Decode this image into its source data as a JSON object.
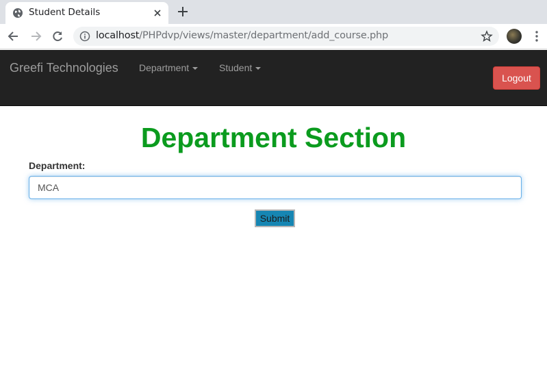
{
  "browser": {
    "tab_title": "Student Details",
    "url_host": "localhost",
    "url_path": "/PHPdvp/views/master/department/add_course.php",
    "icons": {
      "favicon": "globe-icon",
      "close": "close-icon",
      "new_tab": "plus-icon",
      "back": "back-arrow-icon",
      "forward": "forward-arrow-icon",
      "reload": "reload-icon",
      "site_info": "info-icon",
      "bookmark": "star-icon",
      "menu": "kebab-menu-icon"
    }
  },
  "navbar": {
    "brand": "Greefi Technologies",
    "items": [
      {
        "label": "Department"
      },
      {
        "label": "Student"
      }
    ],
    "logout_label": "Logout",
    "colors": {
      "background": "#222222",
      "logout": "#d9534f"
    }
  },
  "main": {
    "heading": "Department Section",
    "heading_color": "#0b9b1e",
    "department_label": "Department:",
    "department_value": "MCA",
    "submit_label": "Submit"
  }
}
